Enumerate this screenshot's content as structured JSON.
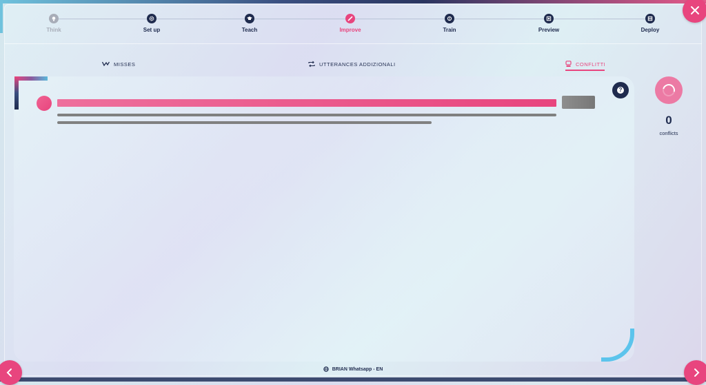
{
  "stepper": {
    "steps": [
      {
        "label": "Think",
        "icon": "bulb-icon",
        "state": "disabled"
      },
      {
        "label": "Set up",
        "icon": "gear-icon",
        "state": "done"
      },
      {
        "label": "Teach",
        "icon": "graduation-cap-icon",
        "state": "done"
      },
      {
        "label": "Improve",
        "icon": "pencil-icon",
        "state": "active"
      },
      {
        "label": "Train",
        "icon": "brain-icon",
        "state": "done"
      },
      {
        "label": "Preview",
        "icon": "preview-icon",
        "state": "done"
      },
      {
        "label": "Deploy",
        "icon": "deploy-icon",
        "state": "done"
      }
    ]
  },
  "tabs": [
    {
      "label": "MISSES",
      "icon": "misses-icon"
    },
    {
      "label": "UTTERANCES ADDIZIONALI",
      "icon": "repeat-icon"
    },
    {
      "label": "CONFLITTI",
      "icon": "conflict-icon",
      "active": true
    }
  ],
  "conflicts": {
    "count": "0",
    "label": "conflicts"
  },
  "footer": {
    "bot_name": "BRIAN Whatsapp - EN",
    "icon": "globe-icon"
  },
  "colors": {
    "accent": "#e8457e",
    "navy": "#1f2b4e",
    "cyan": "#5cc4ec"
  }
}
